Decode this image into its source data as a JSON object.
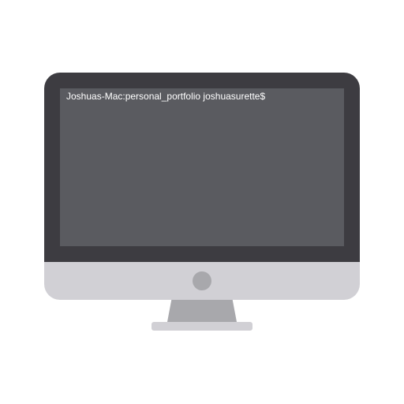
{
  "terminal": {
    "prompt_text": "Joshuas-Mac:personal_portfolio joshuasurette$"
  },
  "colors": {
    "bezel": "#3d3c41",
    "screen": "#5a5b60",
    "chin": "#d1d0d5",
    "stand": "#a8a8ac",
    "text": "#ffffff"
  },
  "icons": {
    "power": "power-button-icon"
  }
}
